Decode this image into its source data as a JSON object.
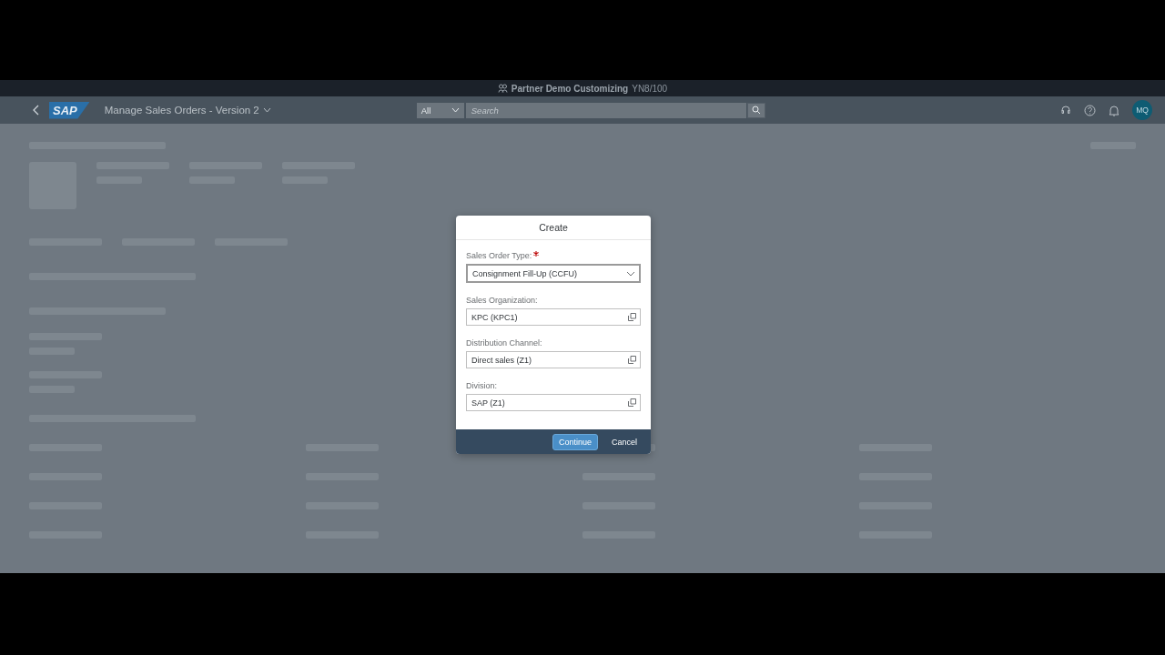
{
  "system_bar": {
    "title": "Partner Demo Customizing",
    "system": "YN8/100"
  },
  "shell": {
    "logo": "SAP",
    "app_title": "Manage Sales Orders - Version 2",
    "search_scope": "All",
    "search_placeholder": "Search",
    "avatar": "MQ"
  },
  "dialog": {
    "title": "Create",
    "fields": [
      {
        "label": "Sales Order Type:",
        "required": true,
        "value": "Consignment Fill-Up (CCFU)",
        "kind": "dropdown"
      },
      {
        "label": "Sales Organization:",
        "required": false,
        "value": "KPC (KPC1)",
        "kind": "value-help"
      },
      {
        "label": "Distribution Channel:",
        "required": false,
        "value": "Direct sales (Z1)",
        "kind": "value-help"
      },
      {
        "label": "Division:",
        "required": false,
        "value": "SAP (Z1)",
        "kind": "value-help"
      }
    ],
    "buttons": [
      {
        "label": "Continue",
        "kind": "emphasized"
      },
      {
        "label": "Cancel",
        "kind": "transparent"
      }
    ]
  }
}
